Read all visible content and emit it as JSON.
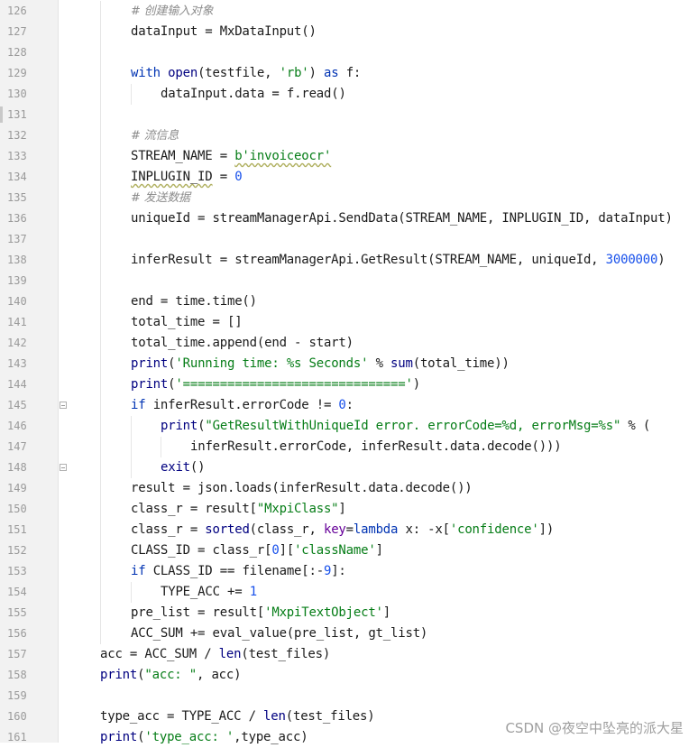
{
  "editor": {
    "lines": [
      {
        "num": "126",
        "indent": 2,
        "tokens": [
          {
            "t": "# 创建输入对象",
            "c": "cm"
          }
        ]
      },
      {
        "num": "127",
        "indent": 2,
        "tokens": [
          {
            "t": "dataInput = MxDataInput()",
            "c": ""
          }
        ]
      },
      {
        "num": "128",
        "indent": 2,
        "tokens": []
      },
      {
        "num": "129",
        "indent": 2,
        "tokens": [
          {
            "t": "with",
            "c": "kw"
          },
          {
            "t": " ",
            "c": ""
          },
          {
            "t": "open",
            "c": "bi"
          },
          {
            "t": "(testfile, ",
            "c": ""
          },
          {
            "t": "'rb'",
            "c": "st"
          },
          {
            "t": ") ",
            "c": ""
          },
          {
            "t": "as",
            "c": "kw"
          },
          {
            "t": " f:",
            "c": ""
          }
        ]
      },
      {
        "num": "130",
        "indent": 3,
        "tokens": [
          {
            "t": "dataInput.data = f.read()",
            "c": ""
          }
        ]
      },
      {
        "num": "131",
        "indent": 2,
        "tokens": []
      },
      {
        "num": "132",
        "indent": 2,
        "tokens": [
          {
            "t": "# 流信息",
            "c": "cm"
          }
        ]
      },
      {
        "num": "133",
        "indent": 2,
        "tokens": [
          {
            "t": "STREAM_NAME = ",
            "c": ""
          },
          {
            "t": "b'invoiceocr'",
            "c": "st wavy"
          }
        ]
      },
      {
        "num": "134",
        "indent": 2,
        "tokens": [
          {
            "t": "INPLUGIN_ID",
            "c": "wavy"
          },
          {
            "t": " = ",
            "c": ""
          },
          {
            "t": "0",
            "c": "nm"
          }
        ]
      },
      {
        "num": "135",
        "indent": 2,
        "tokens": [
          {
            "t": "# 发送数据",
            "c": "cm"
          }
        ]
      },
      {
        "num": "136",
        "indent": 2,
        "tokens": [
          {
            "t": "uniqueId = streamManagerApi.SendData(STREAM_NAME, INPLUGIN_ID, dataInput)",
            "c": ""
          }
        ]
      },
      {
        "num": "137",
        "indent": 2,
        "tokens": []
      },
      {
        "num": "138",
        "indent": 2,
        "tokens": [
          {
            "t": "inferResult = streamManagerApi.GetResult(STREAM_NAME, uniqueId, ",
            "c": ""
          },
          {
            "t": "3000000",
            "c": "nm"
          },
          {
            "t": ")",
            "c": ""
          }
        ]
      },
      {
        "num": "139",
        "indent": 2,
        "tokens": []
      },
      {
        "num": "140",
        "indent": 2,
        "tokens": [
          {
            "t": "end = time.time()",
            "c": ""
          }
        ]
      },
      {
        "num": "141",
        "indent": 2,
        "tokens": [
          {
            "t": "total_time = []",
            "c": ""
          }
        ]
      },
      {
        "num": "142",
        "indent": 2,
        "tokens": [
          {
            "t": "total_time.append(end - start)",
            "c": ""
          }
        ]
      },
      {
        "num": "143",
        "indent": 2,
        "tokens": [
          {
            "t": "print",
            "c": "bi"
          },
          {
            "t": "(",
            "c": ""
          },
          {
            "t": "'Running time: %s Seconds'",
            "c": "st"
          },
          {
            "t": " % ",
            "c": ""
          },
          {
            "t": "sum",
            "c": "bi"
          },
          {
            "t": "(total_time))",
            "c": ""
          }
        ]
      },
      {
        "num": "144",
        "indent": 2,
        "tokens": [
          {
            "t": "print",
            "c": "bi"
          },
          {
            "t": "(",
            "c": ""
          },
          {
            "t": "'=============================='",
            "c": "st"
          },
          {
            "t": ")",
            "c": ""
          }
        ]
      },
      {
        "num": "145",
        "indent": 2,
        "fold": "open",
        "tokens": [
          {
            "t": "if",
            "c": "kw"
          },
          {
            "t": " inferResult.errorCode != ",
            "c": ""
          },
          {
            "t": "0",
            "c": "nm"
          },
          {
            "t": ":",
            "c": ""
          }
        ]
      },
      {
        "num": "146",
        "indent": 3,
        "tokens": [
          {
            "t": "print",
            "c": "bi"
          },
          {
            "t": "(",
            "c": ""
          },
          {
            "t": "\"GetResultWithUniqueId error. errorCode=%d, errorMsg=%s\"",
            "c": "st"
          },
          {
            "t": " % (",
            "c": ""
          }
        ]
      },
      {
        "num": "147",
        "indent": 4,
        "tokens": [
          {
            "t": "inferResult.errorCode, inferResult.data.decode()))",
            "c": ""
          }
        ]
      },
      {
        "num": "148",
        "indent": 3,
        "fold": "end",
        "tokens": [
          {
            "t": "exit",
            "c": "bi"
          },
          {
            "t": "()",
            "c": ""
          }
        ]
      },
      {
        "num": "149",
        "indent": 2,
        "tokens": [
          {
            "t": "result = json.loads(inferResult.data.decode())",
            "c": ""
          }
        ]
      },
      {
        "num": "150",
        "indent": 2,
        "tokens": [
          {
            "t": "class_r = result[",
            "c": ""
          },
          {
            "t": "\"MxpiClass\"",
            "c": "st"
          },
          {
            "t": "]",
            "c": ""
          }
        ]
      },
      {
        "num": "151",
        "indent": 2,
        "tokens": [
          {
            "t": "class_r = ",
            "c": ""
          },
          {
            "t": "sorted",
            "c": "bi"
          },
          {
            "t": "(class_r, ",
            "c": ""
          },
          {
            "t": "key",
            "c": "pr"
          },
          {
            "t": "=",
            "c": ""
          },
          {
            "t": "lambda",
            "c": "kw"
          },
          {
            "t": " x: -x[",
            "c": ""
          },
          {
            "t": "'confidence'",
            "c": "st"
          },
          {
            "t": "])",
            "c": ""
          }
        ]
      },
      {
        "num": "152",
        "indent": 2,
        "tokens": [
          {
            "t": "CLASS_ID = class_r[",
            "c": ""
          },
          {
            "t": "0",
            "c": "nm"
          },
          {
            "t": "][",
            "c": ""
          },
          {
            "t": "'className'",
            "c": "st"
          },
          {
            "t": "]",
            "c": ""
          }
        ]
      },
      {
        "num": "153",
        "indent": 2,
        "tokens": [
          {
            "t": "if",
            "c": "kw"
          },
          {
            "t": " CLASS_ID == filename[:-",
            "c": ""
          },
          {
            "t": "9",
            "c": "nm"
          },
          {
            "t": "]:",
            "c": ""
          }
        ]
      },
      {
        "num": "154",
        "indent": 3,
        "tokens": [
          {
            "t": "TYPE_ACC += ",
            "c": ""
          },
          {
            "t": "1",
            "c": "nm"
          }
        ]
      },
      {
        "num": "155",
        "indent": 2,
        "tokens": [
          {
            "t": "pre_list = result[",
            "c": ""
          },
          {
            "t": "'MxpiTextObject'",
            "c": "st"
          },
          {
            "t": "]",
            "c": ""
          }
        ]
      },
      {
        "num": "156",
        "indent": 2,
        "tokens": [
          {
            "t": "ACC_SUM += eval_value(pre_list, gt_list)",
            "c": ""
          }
        ]
      },
      {
        "num": "157",
        "indent": 1,
        "tokens": [
          {
            "t": "acc = ACC_SUM / ",
            "c": ""
          },
          {
            "t": "len",
            "c": "bi"
          },
          {
            "t": "(test_files)",
            "c": ""
          }
        ]
      },
      {
        "num": "158",
        "indent": 1,
        "tokens": [
          {
            "t": "print",
            "c": "bi"
          },
          {
            "t": "(",
            "c": ""
          },
          {
            "t": "\"acc: \"",
            "c": "st"
          },
          {
            "t": ", acc)",
            "c": ""
          }
        ]
      },
      {
        "num": "159",
        "indent": 1,
        "tokens": []
      },
      {
        "num": "160",
        "indent": 1,
        "tokens": [
          {
            "t": "type_acc = TYPE_ACC / ",
            "c": ""
          },
          {
            "t": "len",
            "c": "bi"
          },
          {
            "t": "(test_files)",
            "c": ""
          }
        ]
      },
      {
        "num": "161",
        "indent": 1,
        "tokens": [
          {
            "t": "print",
            "c": "bi"
          },
          {
            "t": "(",
            "c": ""
          },
          {
            "t": "'type_acc: '",
            "c": "st"
          },
          {
            "t": ",type_acc)",
            "c": ""
          }
        ]
      }
    ]
  },
  "watermark": "CSDN @夜空中坠亮的派大星",
  "colors": {
    "keyword": "#0033b3",
    "comment": "#8c8c8c",
    "string": "#067d17",
    "number": "#1750eb",
    "builtin": "#000080",
    "param": "#660099"
  }
}
